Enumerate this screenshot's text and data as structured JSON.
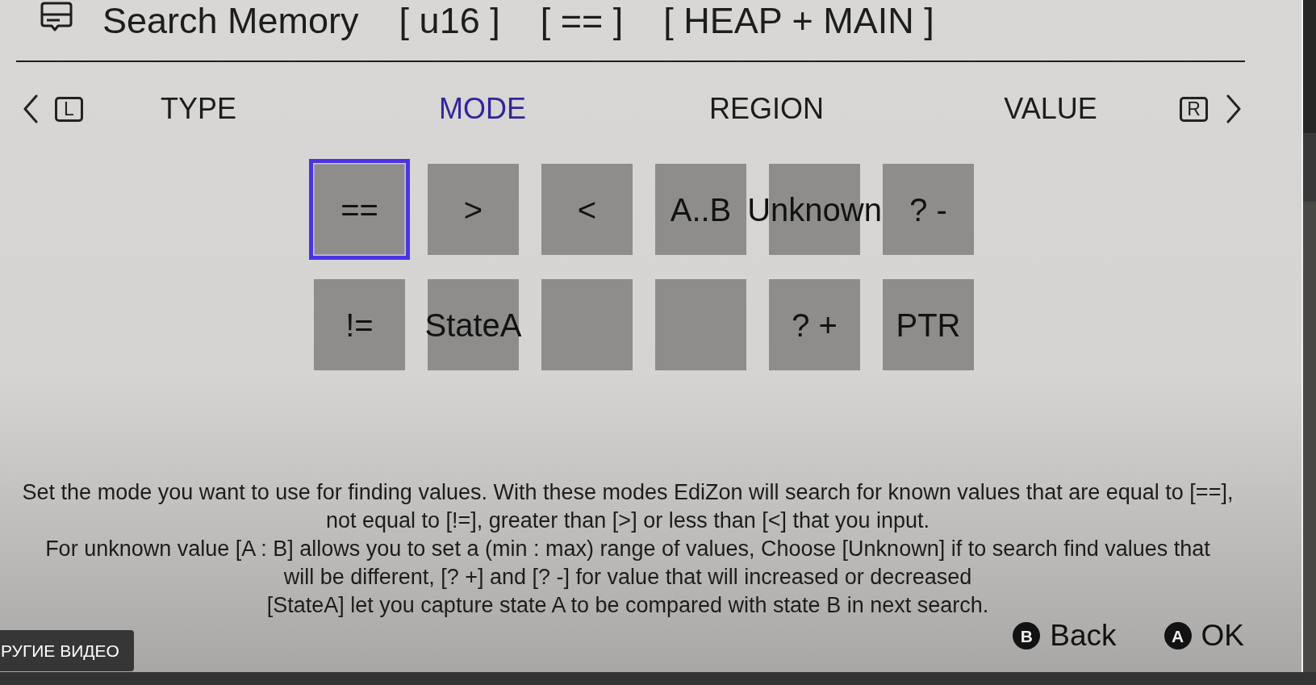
{
  "header": {
    "title": "Search Memory",
    "tags": [
      "[ u16 ]",
      "[ == ]",
      "[ HEAP + MAIN ]"
    ]
  },
  "tab_bar": {
    "prev_key": "L",
    "next_key": "R",
    "tabs": [
      {
        "label": "TYPE",
        "selected": false
      },
      {
        "label": "MODE",
        "selected": true
      },
      {
        "label": "REGION",
        "selected": false
      },
      {
        "label": "VALUE",
        "selected": false
      }
    ]
  },
  "mode_grid": {
    "rows": [
      {
        "cells": [
          {
            "label": "==",
            "selected": true
          },
          {
            "label": ">",
            "selected": false
          },
          {
            "label": "<",
            "selected": false
          },
          {
            "label": "A..B",
            "selected": false
          },
          {
            "label": "Unknown",
            "selected": false
          },
          {
            "label": "? -",
            "selected": false
          }
        ]
      },
      {
        "cells": [
          {
            "label": "!=",
            "selected": false
          },
          {
            "label": "StateA",
            "selected": false
          },
          {
            "selected": false
          },
          {
            "selected": false
          },
          {
            "label": "? +",
            "selected": false
          },
          {
            "label": "PTR",
            "selected": false
          }
        ]
      }
    ]
  },
  "description": {
    "lines": [
      "Set the mode you want to use for finding values. With these modes EdiZon will search for known values that are equal to [==],",
      "not equal to [!=], greater than [>] or less than [<] that you input.",
      "For unknown value [A : B] allows you to set a (min : max) range of values, Choose [Unknown] if to search find values that",
      "will be different, [? +] and [? -] for value that will increased or decreased",
      "[StateA] let you capture state A to be compared with state B in next search."
    ]
  },
  "footer": {
    "buttons": [
      {
        "key": "B",
        "label": "Back"
      },
      {
        "key": "A",
        "label": "OK"
      }
    ]
  },
  "video_overlay": {
    "label": "РУГИЕ ВИДЕО"
  }
}
